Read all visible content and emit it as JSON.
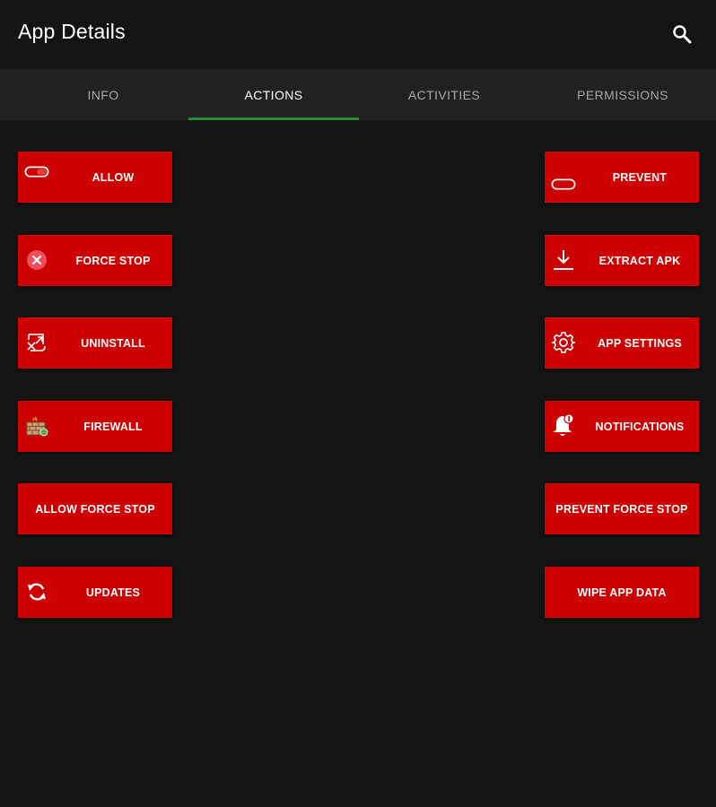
{
  "app_bar": {
    "title": "App Details",
    "search_icon": "search-icon"
  },
  "tabs": [
    {
      "label": "INFO",
      "active": false
    },
    {
      "label": "ACTIONS",
      "active": true
    },
    {
      "label": "ACTIVITIES",
      "active": false
    },
    {
      "label": "PERMISSIONS",
      "active": false
    }
  ],
  "colors": {
    "background": "#141414",
    "tab_bar": "#212121",
    "button": "#cc0000",
    "tab_indicator": "#2e8b3a"
  },
  "actions": {
    "allow": {
      "label": "ALLOW",
      "icon": "toggle-on-icon"
    },
    "prevent": {
      "label": "PREVENT",
      "icon": "toggle-off-icon"
    },
    "force_stop": {
      "label": "FORCE STOP",
      "icon": "close-circle-icon"
    },
    "extract_apk": {
      "label": "EXTRACT APK",
      "icon": "download-icon"
    },
    "uninstall": {
      "label": "UNINSTALL",
      "icon": "uninstall-icon"
    },
    "app_settings": {
      "label": "APP SETTINGS",
      "icon": "gear-icon"
    },
    "firewall": {
      "label": "FIREWALL",
      "icon": "firewall-icon"
    },
    "notifications": {
      "label": "NOTIFICATIONS",
      "icon": "bell-icon"
    },
    "allow_force_stop": {
      "label": "ALLOW FORCE STOP"
    },
    "prevent_force_stop": {
      "label": "PREVENT FORCE STOP"
    },
    "updates": {
      "label": "UPDATES",
      "icon": "refresh-icon"
    },
    "wipe_app_data": {
      "label": "WIPE APP DATA"
    }
  }
}
